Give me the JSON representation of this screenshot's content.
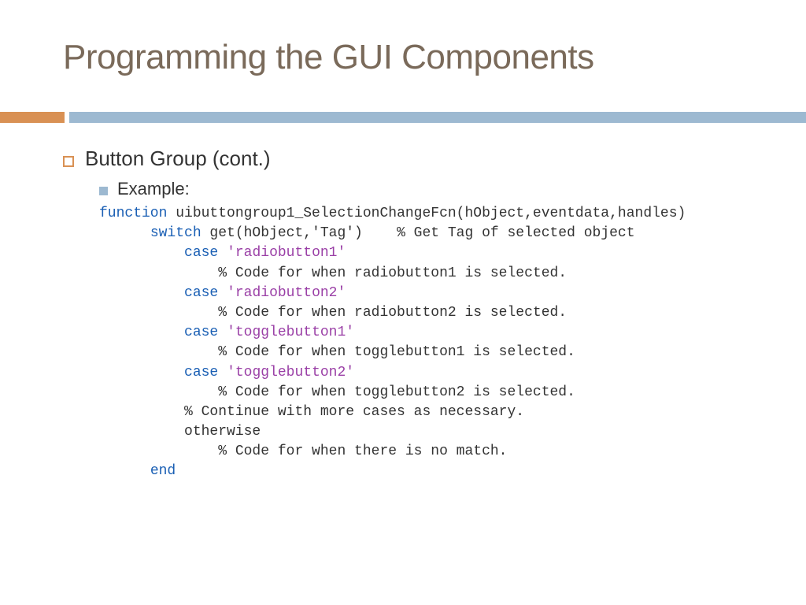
{
  "title": "Programming the GUI Components",
  "bullet1": "Button Group (cont.)",
  "bullet2": "Example:",
  "code": {
    "l0_kw": "function",
    "l0_rest": " uibuttongroup1_SelectionChangeFcn(hObject,eventdata,handles)",
    "l1_pre": "      ",
    "l1_kw": "switch",
    "l1_rest": " get(hObject,'Tag')    % Get Tag of selected object",
    "l2_pre": "          ",
    "l2_kw": "case",
    "l2_sp": " ",
    "l2_str": "'radiobutton1'",
    "l3": "              % Code for when radiobutton1 is selected.",
    "l4_pre": "          ",
    "l4_kw": "case",
    "l4_sp": " ",
    "l4_str": "'radiobutton2'",
    "l5": "              % Code for when radiobutton2 is selected.",
    "l6_pre": "          ",
    "l6_kw": "case",
    "l6_sp": " ",
    "l6_str": "'togglebutton1'",
    "l7": "              % Code for when togglebutton1 is selected.",
    "l8_pre": "          ",
    "l8_kw": "case",
    "l8_sp": " ",
    "l8_str": "'togglebutton2'",
    "l9": "              % Code for when togglebutton2 is selected.",
    "l10": "          % Continue with more cases as necessary.",
    "l11": "          otherwise",
    "l12": "              % Code for when there is no match.",
    "l13_pre": "      ",
    "l13_kw": "end"
  }
}
